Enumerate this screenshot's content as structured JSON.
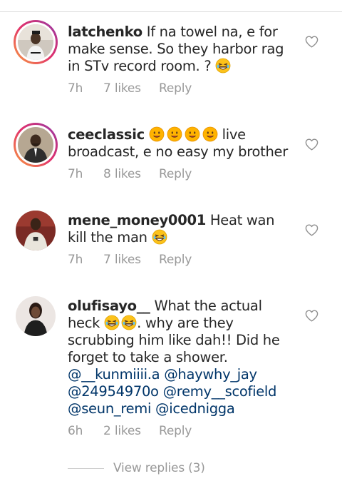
{
  "comments": [
    {
      "username": "latchenko",
      "text_before": " If na towel na, e for make sense. So they harbor rag in STv record room. ? ",
      "time": "7h",
      "likes": "7 likes",
      "reply": "Reply"
    },
    {
      "username": "ceeclassic",
      "text_after": " live broadcast, e no easy my brother",
      "time": "7h",
      "likes": "8 likes",
      "reply": "Reply"
    },
    {
      "username": "mene_money0001",
      "text_before": " Heat wan kill the man ",
      "time": "7h",
      "likes": "7 likes",
      "reply": "Reply"
    },
    {
      "username": "olufisayo__",
      "text_before": " What the actual heck ",
      "text_mid": ". why are they scrubbing him like dah!! Did he forget to take a shower. ",
      "mentions": [
        "@__kunmiiii.a",
        "@haywhy_jay",
        "@24954970o",
        "@remy__scofield",
        "@seun_remi",
        "@icednigga"
      ],
      "time": "6h",
      "likes": "2 likes",
      "reply": "Reply"
    }
  ],
  "view_replies": "View replies (3)",
  "icons": {
    "like": "heart-outline-icon",
    "laugh": "grinning-squinting-face-emoji",
    "smile": "slightly-smiling-face-emoji"
  },
  "colors": {
    "text": "#262626",
    "meta": "#999999",
    "mention": "#003569",
    "story_ring_start": "#f9a03f",
    "story_ring_end": "#833ab4"
  }
}
